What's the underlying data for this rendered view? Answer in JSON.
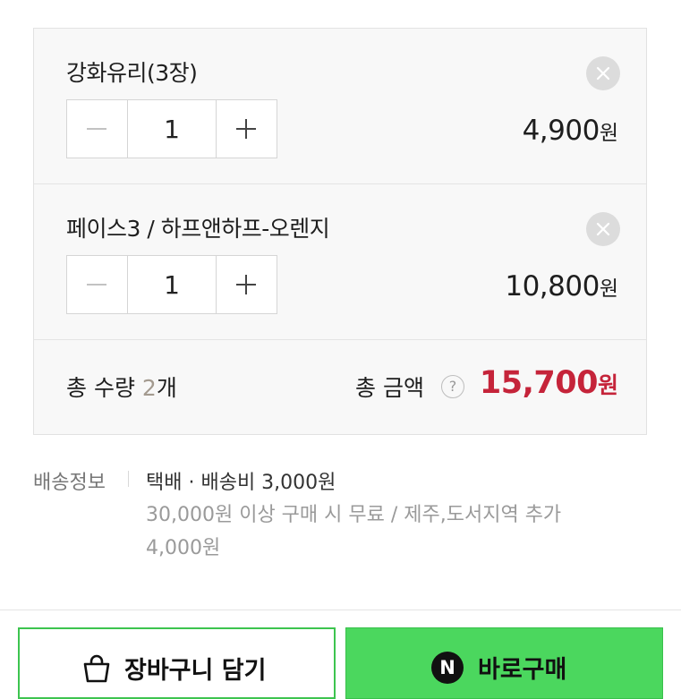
{
  "items": [
    {
      "name": "강화유리(3장)",
      "quantity": "1",
      "price": "4,900",
      "price_unit": "원",
      "remove_icon": "close-icon",
      "minus_icon": "minus-icon",
      "plus_icon": "plus-icon"
    },
    {
      "name": "페이스3 / 하프앤하프-오렌지",
      "quantity": "1",
      "price": "10,800",
      "price_unit": "원",
      "remove_icon": "close-icon",
      "minus_icon": "minus-icon",
      "plus_icon": "plus-icon"
    }
  ],
  "summary": {
    "total_qty_prefix": "총 수량 ",
    "total_qty_value": "2",
    "total_qty_suffix": "개",
    "total_amount_label": "총 금액",
    "help_glyph": "?",
    "total_price": "15,700",
    "total_price_unit": "원"
  },
  "shipping": {
    "label": "배송정보",
    "type": "택배 · 배송비 3,000원",
    "condition": "30,000원 이상 구매 시 무료 / 제주,도서지역 추가",
    "extra": "4,000원"
  },
  "buttons": {
    "cart_label": "장바구니 담기",
    "cart_icon": "shopping-bag-icon",
    "buy_label": "바로구매",
    "buy_logo_letter": "N"
  },
  "colors": {
    "total_price": "#c5243a",
    "total_qty_number": "#a39a8f",
    "buy_button": "#4bd75e",
    "cart_button_border": "#3dc44f"
  }
}
